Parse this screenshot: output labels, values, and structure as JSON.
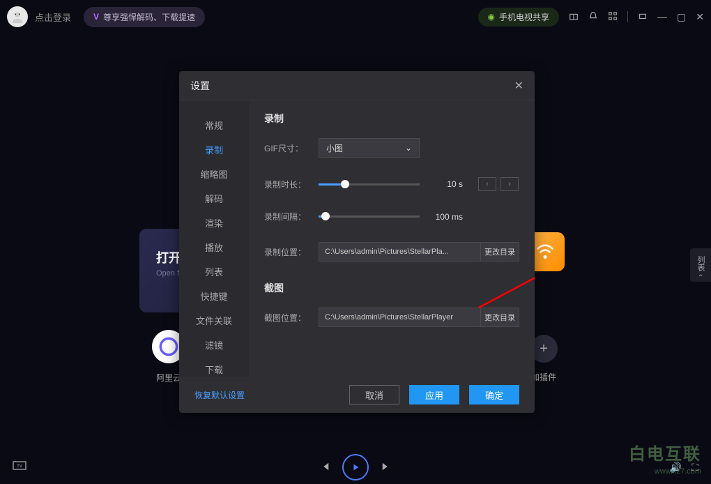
{
  "header": {
    "login_text": "点击登录",
    "promo": "尊享强悍解码、下载提速",
    "mobile_share": "手机电视共享"
  },
  "main": {
    "open_title": "打开文件",
    "open_sub": "Open file",
    "feat1": "阿里云",
    "add_plugin": "加插件",
    "side_tab": "列表"
  },
  "modal": {
    "title": "设置",
    "sidebar": [
      "常规",
      "录制",
      "缩略图",
      "解码",
      "渲染",
      "播放",
      "列表",
      "快捷键",
      "文件关联",
      "滤镜",
      "下载"
    ],
    "record": {
      "section": "录制",
      "gif_label": "GIF尺寸：",
      "gif_value": "小图",
      "duration_label": "录制时长：",
      "duration_value": "10 s",
      "interval_label": "录制间隔：",
      "interval_value": "100 ms",
      "path_label": "录制位置：",
      "path_value": "C:\\Users\\admin\\Pictures\\StellarPla...",
      "change_dir": "更改目录"
    },
    "screenshot": {
      "section": "截图",
      "path_label": "截图位置：",
      "path_value": "C:\\Users\\admin\\Pictures\\StellarPlayer",
      "change_dir": "更改目录"
    },
    "footer": {
      "reset": "恢复默认设置",
      "cancel": "取消",
      "apply": "应用",
      "ok": "确定"
    }
  },
  "watermark": {
    "brand": "白电互联",
    "url": "www.xz7.com"
  }
}
